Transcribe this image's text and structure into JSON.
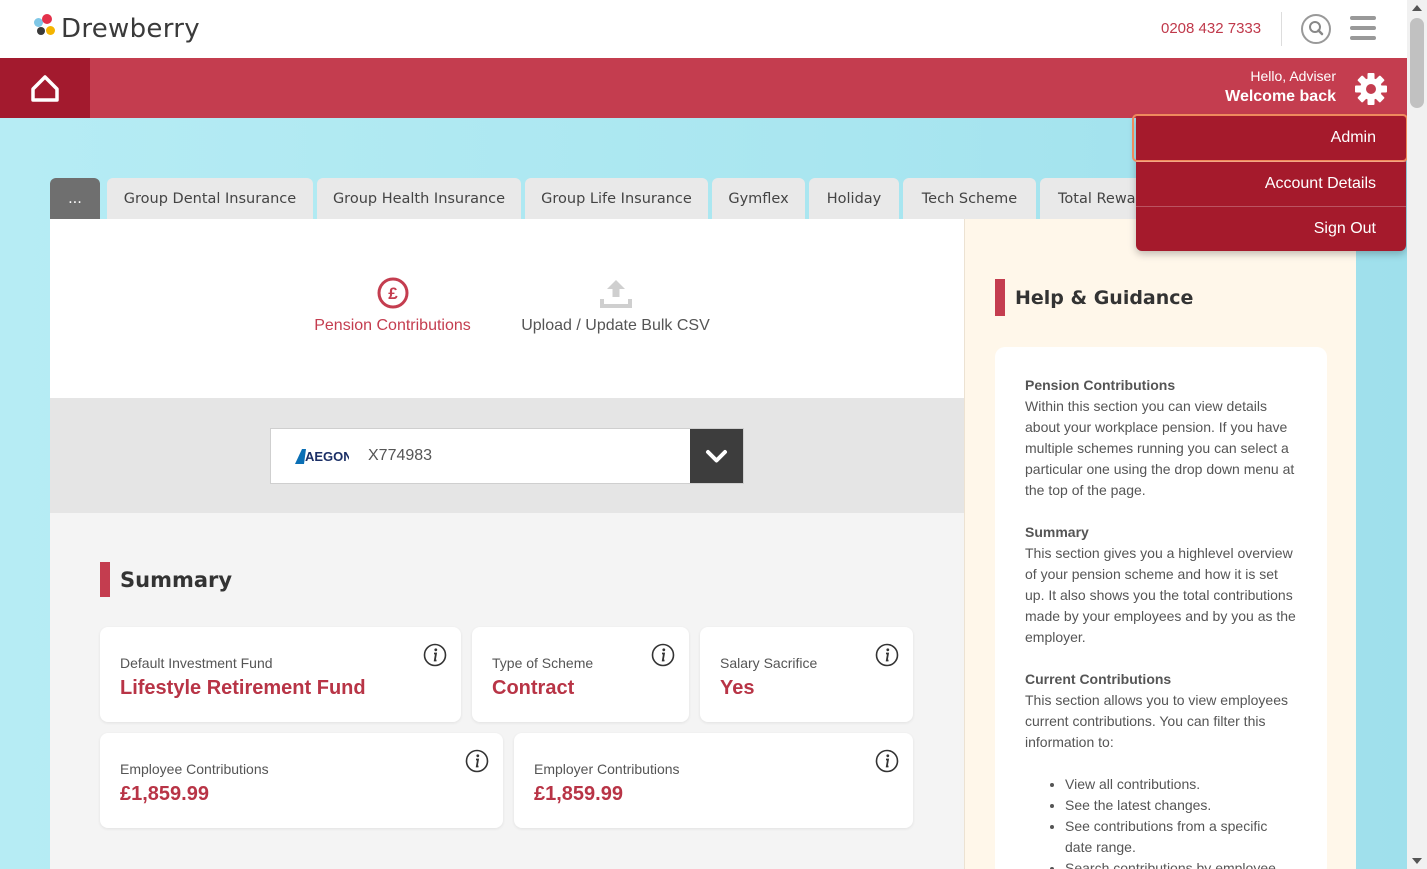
{
  "header": {
    "brand": "Drewberry",
    "phone": "0208 432 7333",
    "greeting": "Hello, Adviser",
    "welcome": "Welcome back",
    "colors": {
      "brand_red": "#c43d4f",
      "dark_red": "#a31a2e",
      "accent_text": "#b83446"
    }
  },
  "user_menu": {
    "items": [
      {
        "label": "Admin"
      },
      {
        "label": "Account Details"
      },
      {
        "label": "Sign Out"
      }
    ]
  },
  "tabs": [
    {
      "label": "..."
    },
    {
      "label": "Group Dental Insurance"
    },
    {
      "label": "Group Health Insurance"
    },
    {
      "label": "Group Life Insurance"
    },
    {
      "label": "Gymflex"
    },
    {
      "label": "Holiday"
    },
    {
      "label": "Tech Scheme"
    },
    {
      "label": "Total Rewa"
    }
  ],
  "subnav": {
    "pension": "Pension Contributions",
    "upload": "Upload / Update Bulk CSV",
    "pension_icon": "pound-icon",
    "upload_icon": "upload-icon"
  },
  "scheme_select": {
    "provider_logo": "AEGON",
    "value": "X774983"
  },
  "summary": {
    "title": "Summary",
    "cards": [
      {
        "label": "Default Investment Fund",
        "value": "Lifestyle Retirement Fund"
      },
      {
        "label": "Type of Scheme",
        "value": "Contract"
      },
      {
        "label": "Salary Sacrifice",
        "value": "Yes"
      },
      {
        "label": "Employee Contributions",
        "value": "£1,859.99"
      },
      {
        "label": "Employer Contributions",
        "value": "£1,859.99"
      }
    ]
  },
  "help": {
    "title": "Help & Guidance",
    "sections": [
      {
        "heading": "Pension Contributions",
        "body": "Within this section you can view details about your workplace pension. If you have multiple schemes running you can select a particular one using the drop down menu at the top of the page."
      },
      {
        "heading": "Summary",
        "body": "This section gives you a highlevel overview of your pension scheme and how it is set up. It also shows you the total contributions made by your employees and by you as the employer."
      },
      {
        "heading": "Current Contributions",
        "body": "This section allows you to view employees current contributions. You can filter this information to:"
      }
    ],
    "bullets": [
      "View all contributions.",
      "See the latest changes.",
      "See contributions from a specific date range.",
      "Search contributions by employee."
    ]
  }
}
